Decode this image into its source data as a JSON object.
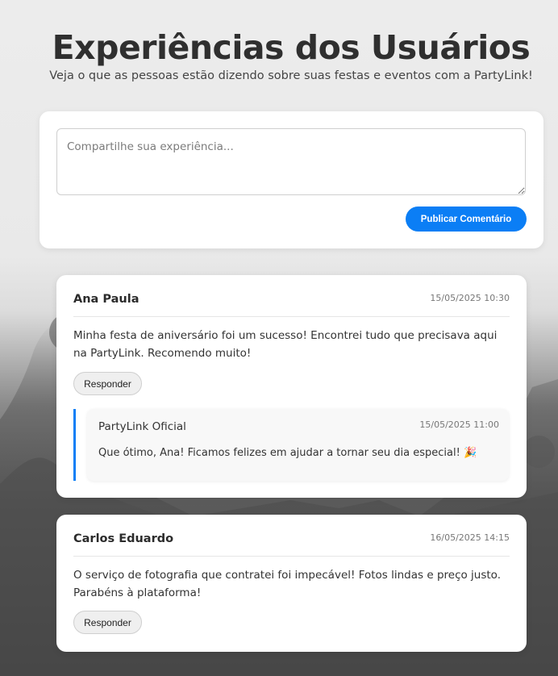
{
  "header": {
    "title": "Experiências dos Usuários",
    "subtitle": "Veja o que as pessoas estão dizendo sobre suas festas e eventos com a PartyLink!"
  },
  "compose": {
    "placeholder": "Compartilhe sua experiência...",
    "value": "",
    "publish_label": "Publicar Comentário"
  },
  "comments": [
    {
      "author": "Ana Paula",
      "date": "15/05/2025 10:30",
      "text": "Minha festa de aniversário foi um sucesso! Encontrei tudo que precisava aqui na PartyLink. Recomendo muito!",
      "reply_label": "Responder",
      "replies": [
        {
          "author": "PartyLink Oficial",
          "date": "15/05/2025 11:00",
          "text": "Que ótimo, Ana! Ficamos felizes em ajudar a tornar seu dia especial! 🎉"
        }
      ]
    },
    {
      "author": "Carlos Eduardo",
      "date": "16/05/2025 14:15",
      "text": "O serviço de fotografia que contratei foi impecável! Fotos lindas e preço justo. Parabéns à plataforma!",
      "reply_label": "Responder"
    }
  ],
  "colors": {
    "accent": "#0b7ef5",
    "title": "#2f2f2f",
    "card": "#ffffff"
  }
}
